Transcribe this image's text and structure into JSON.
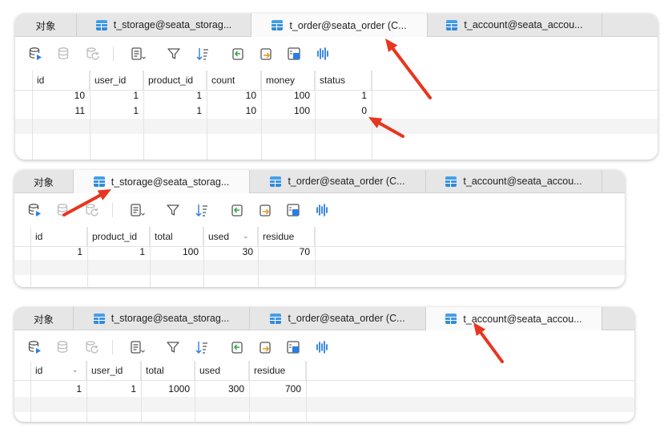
{
  "tab_objects_label": "对象",
  "tab_storage_label": "t_storage@seata_storag...",
  "tab_order_label": "t_order@seata_order (C...",
  "tab_account_label": "t_account@seata_accou...",
  "accent_color": "#e8351f",
  "toolbar_icons": [
    "database-run-icon",
    "database-disabled-icon",
    "refresh-disabled-icon",
    "text-view-icon",
    "filter-icon",
    "sort-icon",
    "import-icon",
    "export-icon",
    "binary-data-icon",
    "chart-icon"
  ],
  "order_table": {
    "active_tab": "t_order",
    "columns": [
      "id",
      "user_id",
      "product_id",
      "count",
      "money",
      "status"
    ],
    "rows": [
      [
        "10",
        "1",
        "1",
        "10",
        "100",
        "1"
      ],
      [
        "11",
        "1",
        "1",
        "10",
        "100",
        "0"
      ]
    ]
  },
  "storage_table": {
    "active_tab": "t_storage",
    "columns": [
      "id",
      "product_id",
      "total",
      "used",
      "residue"
    ],
    "rows": [
      [
        "1",
        "1",
        "100",
        "30",
        "70"
      ]
    ]
  },
  "account_table": {
    "active_tab": "t_account",
    "columns": [
      "id",
      "user_id",
      "total",
      "used",
      "residue"
    ],
    "rows": [
      [
        "1",
        "1",
        "1000",
        "300",
        "700"
      ]
    ]
  }
}
